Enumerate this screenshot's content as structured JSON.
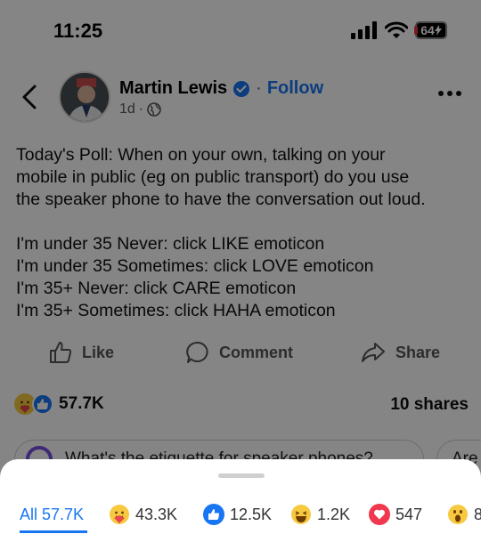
{
  "status_bar": {
    "time": "11:25",
    "battery": "64"
  },
  "post": {
    "author": "Martin Lewis",
    "separator": "·",
    "follow_label": "Follow",
    "age": "1d",
    "meta_separator": "·",
    "lines": [
      "Today's Poll: When on your own, talking on your",
      "mobile in public (eg on public transport) do you use",
      "the speaker phone to have the conversation out loud."
    ],
    "poll_lines": [
      "I'm under 35 Never: click LIKE emoticon",
      "I'm under 35 Sometimes: click LOVE emoticon",
      "I'm 35+ Never: click CARE emoticon",
      "I'm 35+ Sometimes: click HAHA emoticon"
    ]
  },
  "actions": {
    "like": "Like",
    "comment": "Comment",
    "share": "Share"
  },
  "counts": {
    "reactions": "57.7K",
    "shares": "10 shares"
  },
  "suggestions": [
    "What's the etiquette for speaker phones?",
    "Are"
  ],
  "reaction_tabs": [
    {
      "label": "All 57.7K",
      "icon": "all"
    },
    {
      "label": "43.3K",
      "icon": "care-emoji-icon"
    },
    {
      "label": "12.5K",
      "icon": "like-emoji-icon"
    },
    {
      "label": "1.2K",
      "icon": "haha-emoji-icon"
    },
    {
      "label": "547",
      "icon": "love-emoji-icon"
    },
    {
      "label": "8",
      "icon": "wow-emoji-icon"
    }
  ],
  "colors": {
    "brand_blue": "#1876f2",
    "love_red": "#f0384e",
    "emoji_yellow": "#f7c940",
    "overlay": "rgba(0,0,0,0.48)"
  }
}
